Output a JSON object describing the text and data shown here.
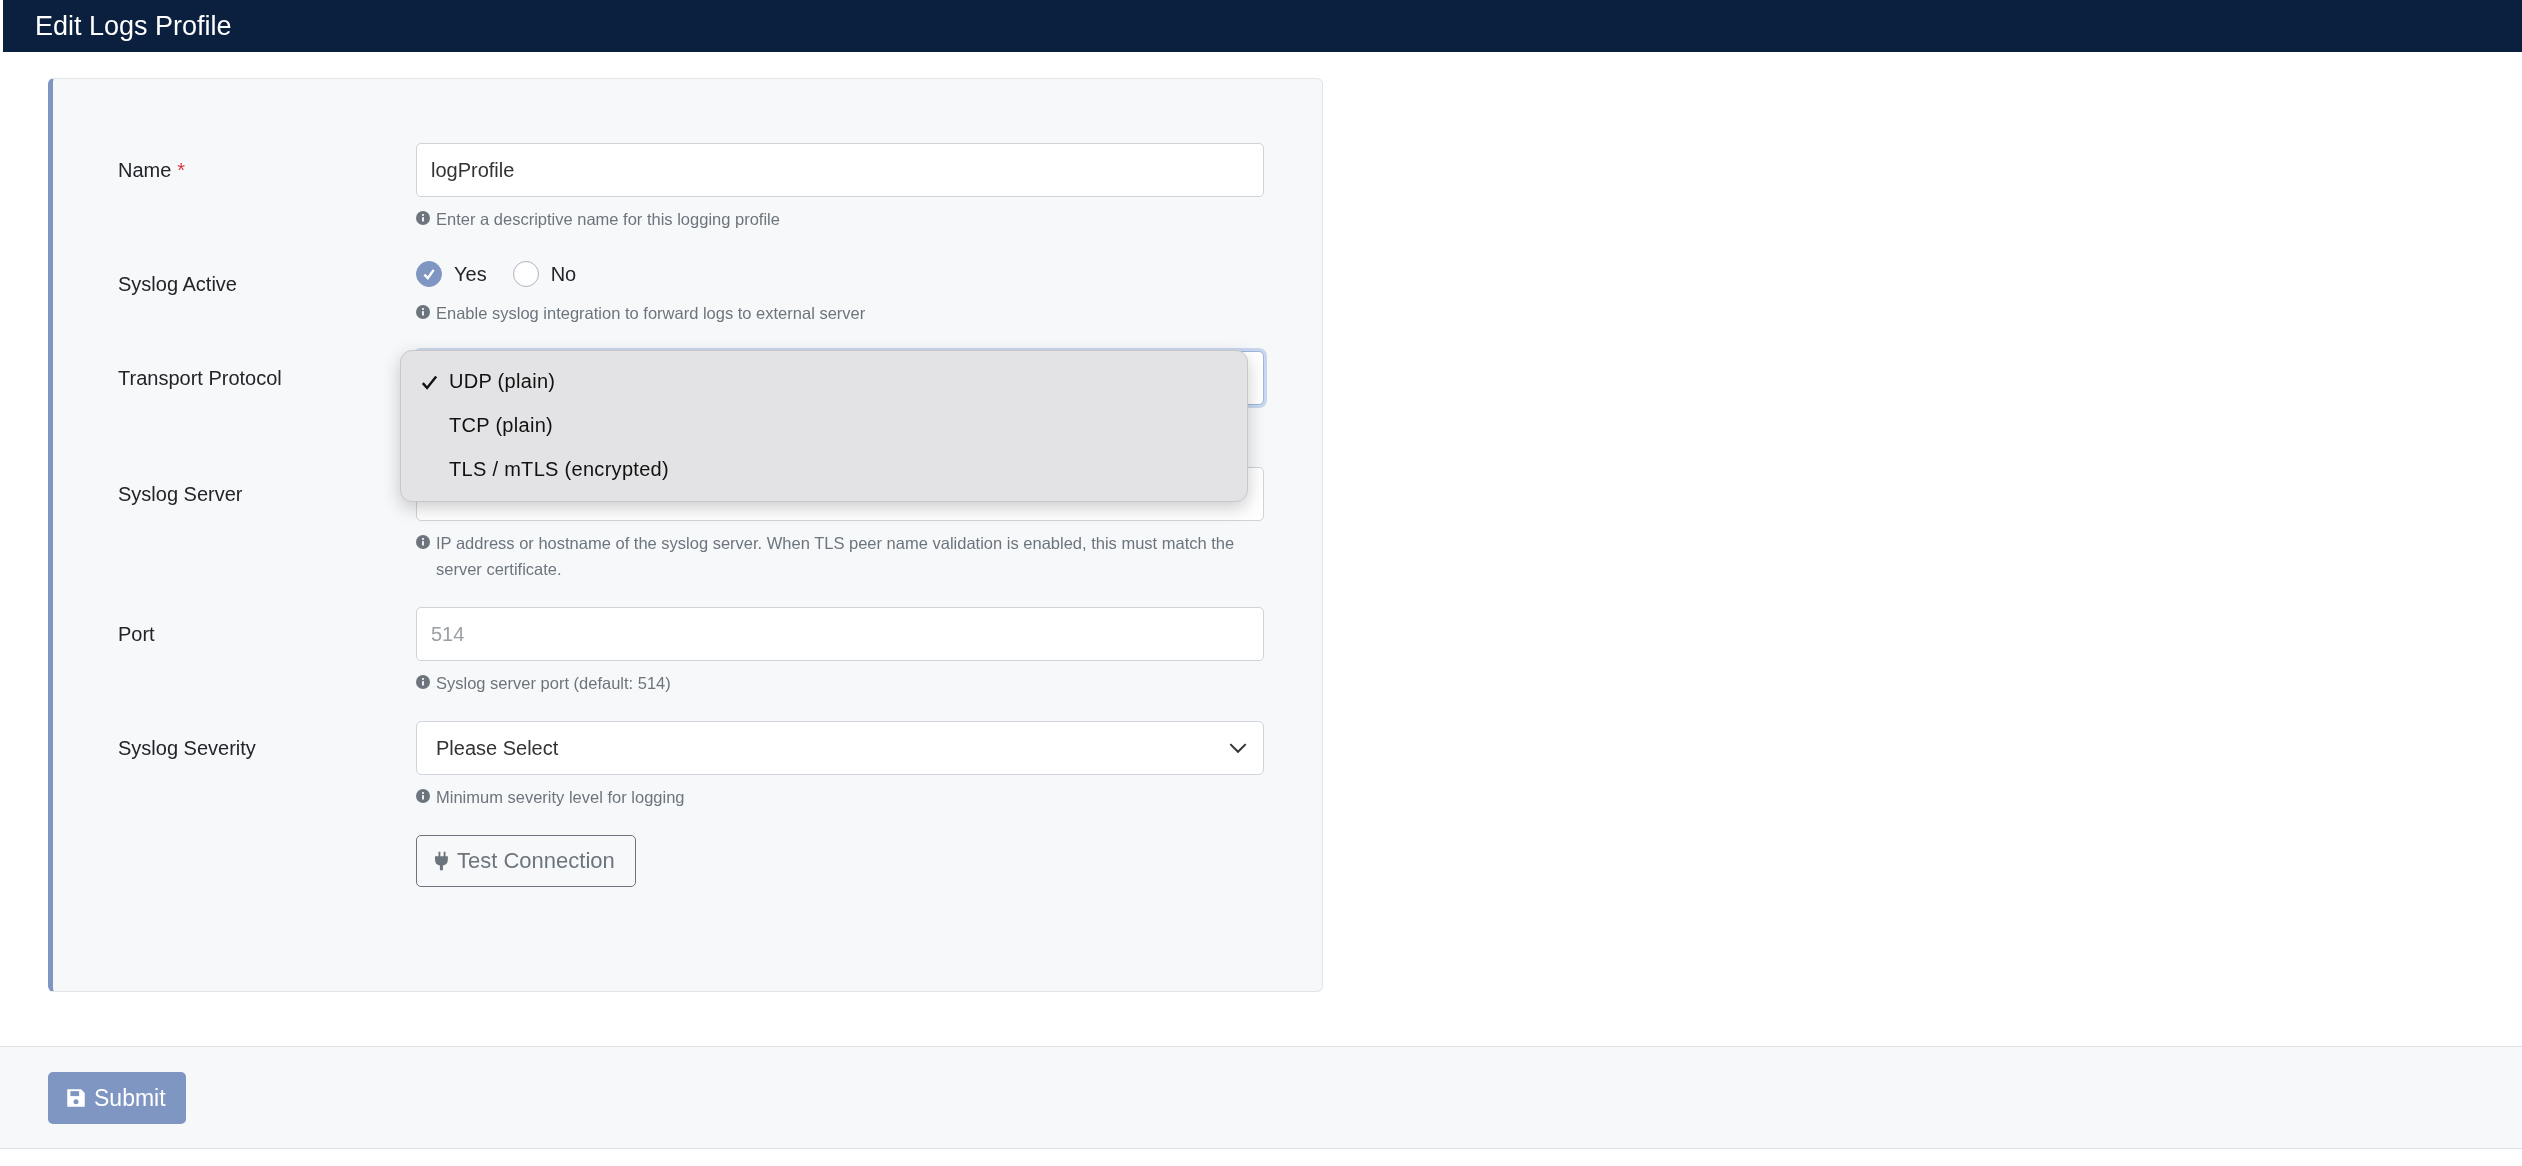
{
  "header": {
    "title": "Edit Logs Profile"
  },
  "form": {
    "fields": [
      {
        "kind": "text",
        "label": "Name",
        "required_mark": "*",
        "value": "logProfile",
        "hint": "Enter a descriptive name for this logging profile"
      },
      {
        "kind": "radio",
        "label": "Syslog Active",
        "options": [
          {
            "label": "Yes",
            "selected": true
          },
          {
            "label": "No",
            "selected": false
          }
        ],
        "hint": "Enable syslog integration to forward logs to external server"
      },
      {
        "kind": "select",
        "label": "Transport Protocol",
        "menu": {
          "options": [
            {
              "label": "UDP (plain)",
              "selected": true
            },
            {
              "label": "TCP (plain)",
              "selected": false
            },
            {
              "label": "TLS / mTLS (encrypted)",
              "selected": false
            }
          ]
        }
      },
      {
        "kind": "text",
        "label": "Syslog Server",
        "hint": "IP address or hostname of the syslog server. When TLS peer name validation is enabled, this must match the server certificate."
      },
      {
        "kind": "text",
        "label": "Port",
        "placeholder": "514",
        "hint": "Syslog server port (default: 514)"
      },
      {
        "kind": "select",
        "label": "Syslog Severity",
        "value": "Please Select",
        "hint": "Minimum severity level for logging"
      }
    ],
    "test_button": "Test Connection"
  },
  "footer": {
    "submit": "Submit"
  }
}
